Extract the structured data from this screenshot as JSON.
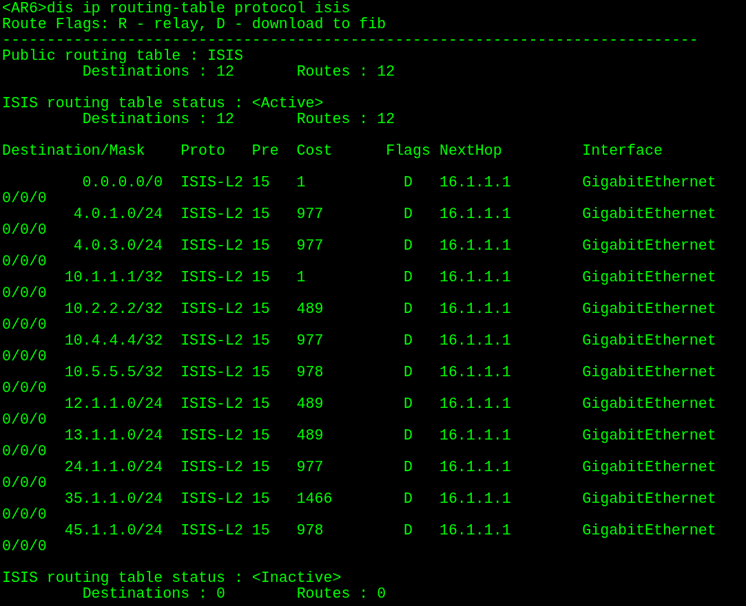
{
  "terminal": {
    "command_line": "<AR6>dis ip routing-table protocol isis",
    "route_flags": "Route Flags: R - relay, D - download to fib",
    "separator": "------------------------------------------------------------------------------",
    "public_table": {
      "title": "Public routing table : ISIS",
      "destinations": "Destinations : 12",
      "routes": "Routes : 12"
    },
    "active_status": {
      "title": "ISIS routing table status : <Active>",
      "destinations": "Destinations : 12",
      "routes": "Routes : 12"
    },
    "columns": [
      "Destination/Mask",
      "Proto",
      "Pre",
      "Cost",
      "Flags",
      "NextHop",
      "Interface"
    ],
    "rows": [
      {
        "destination": "0.0.0.0/0",
        "proto": "ISIS-L2",
        "pre": "15",
        "cost": "1",
        "flags": "D",
        "next_hop": "16.1.1.1",
        "interface": "GigabitEthernet",
        "interface_wrap": "0/0/0"
      },
      {
        "destination": "4.0.1.0/24",
        "proto": "ISIS-L2",
        "pre": "15",
        "cost": "977",
        "flags": "D",
        "next_hop": "16.1.1.1",
        "interface": "GigabitEthernet",
        "interface_wrap": "0/0/0"
      },
      {
        "destination": "4.0.3.0/24",
        "proto": "ISIS-L2",
        "pre": "15",
        "cost": "977",
        "flags": "D",
        "next_hop": "16.1.1.1",
        "interface": "GigabitEthernet",
        "interface_wrap": "0/0/0"
      },
      {
        "destination": "10.1.1.1/32",
        "proto": "ISIS-L2",
        "pre": "15",
        "cost": "1",
        "flags": "D",
        "next_hop": "16.1.1.1",
        "interface": "GigabitEthernet",
        "interface_wrap": "0/0/0"
      },
      {
        "destination": "10.2.2.2/32",
        "proto": "ISIS-L2",
        "pre": "15",
        "cost": "489",
        "flags": "D",
        "next_hop": "16.1.1.1",
        "interface": "GigabitEthernet",
        "interface_wrap": "0/0/0"
      },
      {
        "destination": "10.4.4.4/32",
        "proto": "ISIS-L2",
        "pre": "15",
        "cost": "977",
        "flags": "D",
        "next_hop": "16.1.1.1",
        "interface": "GigabitEthernet",
        "interface_wrap": "0/0/0"
      },
      {
        "destination": "10.5.5.5/32",
        "proto": "ISIS-L2",
        "pre": "15",
        "cost": "978",
        "flags": "D",
        "next_hop": "16.1.1.1",
        "interface": "GigabitEthernet",
        "interface_wrap": "0/0/0"
      },
      {
        "destination": "12.1.1.0/24",
        "proto": "ISIS-L2",
        "pre": "15",
        "cost": "489",
        "flags": "D",
        "next_hop": "16.1.1.1",
        "interface": "GigabitEthernet",
        "interface_wrap": "0/0/0"
      },
      {
        "destination": "13.1.1.0/24",
        "proto": "ISIS-L2",
        "pre": "15",
        "cost": "489",
        "flags": "D",
        "next_hop": "16.1.1.1",
        "interface": "GigabitEthernet",
        "interface_wrap": "0/0/0"
      },
      {
        "destination": "24.1.1.0/24",
        "proto": "ISIS-L2",
        "pre": "15",
        "cost": "977",
        "flags": "D",
        "next_hop": "16.1.1.1",
        "interface": "GigabitEthernet",
        "interface_wrap": "0/0/0"
      },
      {
        "destination": "35.1.1.0/24",
        "proto": "ISIS-L2",
        "pre": "15",
        "cost": "1466",
        "flags": "D",
        "next_hop": "16.1.1.1",
        "interface": "GigabitEthernet",
        "interface_wrap": "0/0/0"
      },
      {
        "destination": "45.1.1.0/24",
        "proto": "ISIS-L2",
        "pre": "15",
        "cost": "978",
        "flags": "D",
        "next_hop": "16.1.1.1",
        "interface": "GigabitEthernet",
        "interface_wrap": "0/0/0"
      }
    ],
    "inactive_status": {
      "title": "ISIS routing table status : <Inactive>",
      "destinations": "Destinations : 0",
      "routes": "Routes : 0"
    }
  }
}
